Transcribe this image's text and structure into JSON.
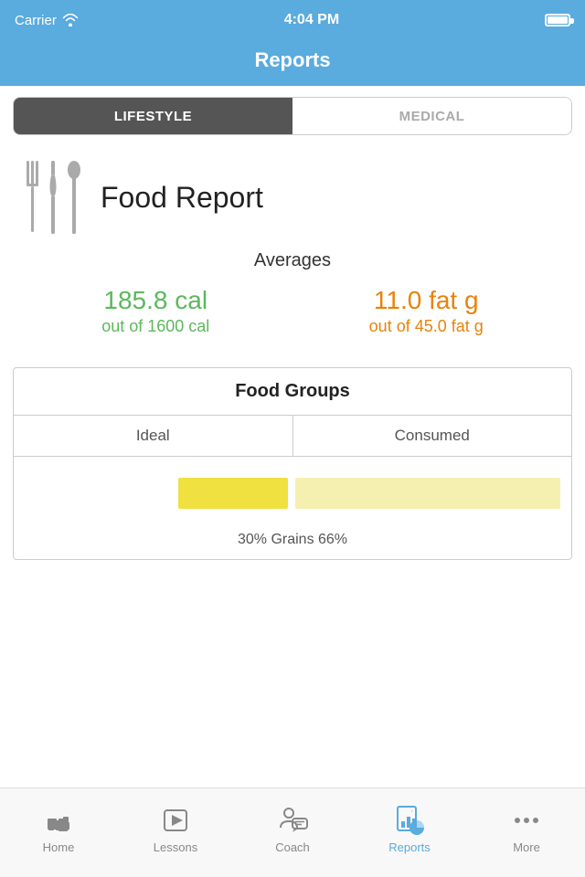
{
  "statusBar": {
    "carrier": "Carrier",
    "time": "4:04 PM"
  },
  "navBar": {
    "title": "Reports"
  },
  "segmentControl": {
    "options": [
      "LIFESTYLE",
      "MEDICAL"
    ],
    "activeIndex": 0
  },
  "foodReport": {
    "title": "Food Report",
    "averages": {
      "label": "Averages",
      "calories": {
        "value": "185.8 cal",
        "sub": "out of 1600 cal"
      },
      "fat": {
        "value": "11.0 fat g",
        "sub": "out of 45.0 fat g"
      }
    },
    "foodGroups": {
      "title": "Food Groups",
      "idealLabel": "Ideal",
      "consumedLabel": "Consumed",
      "grainLabel": "30% Grains 66%",
      "idealBarWidth": 120,
      "consumedBarWidth": 330
    }
  },
  "tabBar": {
    "items": [
      {
        "id": "home",
        "label": "Home",
        "active": false
      },
      {
        "id": "lessons",
        "label": "Lessons",
        "active": false
      },
      {
        "id": "coach",
        "label": "Coach",
        "active": false
      },
      {
        "id": "reports",
        "label": "Reports",
        "active": true
      },
      {
        "id": "more",
        "label": "More",
        "active": false
      }
    ]
  }
}
